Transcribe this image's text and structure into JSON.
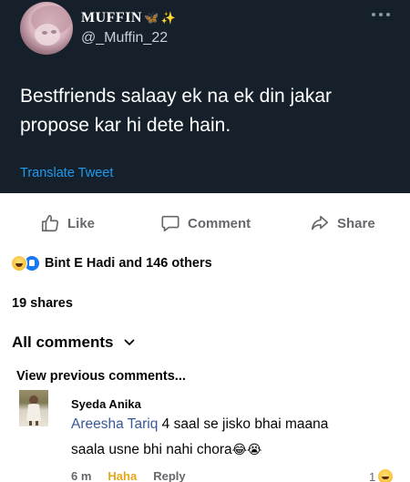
{
  "tweet": {
    "display_name": "MUFFIN",
    "display_name_emojis": [
      "🦋",
      "✨"
    ],
    "handle": "@_Muffin_22",
    "text": "Bestfriends salaay ek na ek din jakar propose kar hi dete hain.",
    "translate_label": "Translate Tweet",
    "more_icon": "more-horizontal-icon"
  },
  "post_actions": {
    "like_label": "Like",
    "comment_label": "Comment",
    "share_label": "Share"
  },
  "reactions": {
    "icons": [
      "haha-reaction",
      "like-reaction"
    ],
    "summary": "Bint E Hadi and 146 others"
  },
  "shares_text": "19 shares",
  "comments_filter": {
    "label": "All comments",
    "icon": "chevron-down-icon"
  },
  "view_previous": "View previous comments...",
  "comment": {
    "author": "Syeda Anika",
    "mention": "Areesha Tariq",
    "text_line1": "4 saal se jisko bhai maana",
    "text_line2": "saala usne bhi nahi chora",
    "emojis": "😂😭",
    "time": "6 m",
    "reaction_label": "Haha",
    "reply_label": "Reply",
    "reaction_count": "1"
  },
  "colors": {
    "tweet_background": "#15202b",
    "link_blue": "#1d9bf0",
    "mention_blue": "#385898",
    "haha_yellow": "#e7a61a",
    "muted_text": "#65676b"
  }
}
